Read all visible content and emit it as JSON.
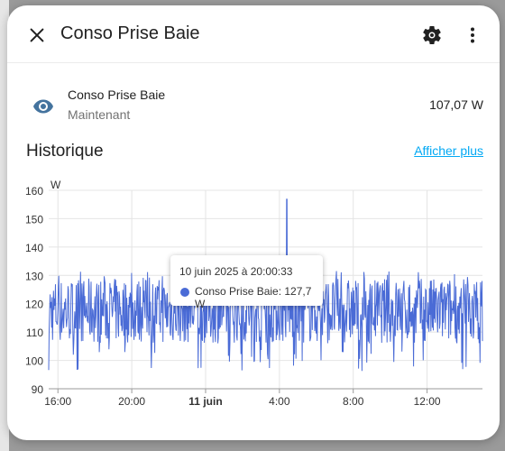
{
  "dialog": {
    "title": "Conso Prise Baie",
    "icons": {
      "close": "close-icon",
      "settings": "gear-icon",
      "menu": "dots-vertical-icon"
    }
  },
  "entity": {
    "icon": "eye-icon",
    "name": "Conso Prise Baie",
    "subtitle": "Maintenant",
    "value": "107,07 W"
  },
  "history": {
    "title": "Historique",
    "show_more": "Afficher plus"
  },
  "tooltip": {
    "time": "10 juin 2025 à 20:00:33",
    "series_text": "Conso Prise Baie: 127,7 W"
  },
  "colors": {
    "series": "#4a6bd6",
    "link": "#03a9f4",
    "icon": "#44739e"
  },
  "chart_data": {
    "type": "line",
    "ylabel": "W",
    "ylim": [
      90,
      160
    ],
    "yticks": [
      "160",
      "150",
      "140",
      "130",
      "120",
      "110",
      "100",
      "90"
    ],
    "x_start_hour": 15.5,
    "x_end_hour": 39,
    "xticks": [
      {
        "label": "16:00",
        "hour": 16,
        "bold": false
      },
      {
        "label": "20:00",
        "hour": 20,
        "bold": false
      },
      {
        "label": "11 juin",
        "hour": 24,
        "bold": true
      },
      {
        "label": "4:00",
        "hour": 28,
        "bold": false
      },
      {
        "label": "8:00",
        "hour": 32,
        "bold": false
      },
      {
        "label": "12:00",
        "hour": 36,
        "bold": false
      }
    ],
    "grid": true,
    "series": [
      {
        "name": "Conso Prise Baie",
        "typical_range": [
          106,
          129
        ],
        "min": 96,
        "max": 157,
        "spike": {
          "hour": 28.4,
          "value": 157
        }
      }
    ]
  }
}
